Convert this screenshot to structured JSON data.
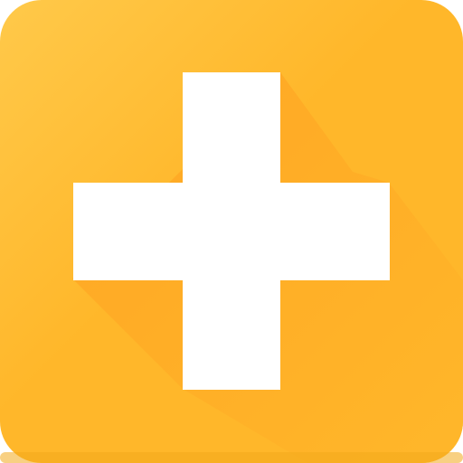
{
  "icon": {
    "name": "plus-icon",
    "colors": {
      "tile_light": "#FFC94A",
      "tile_main": "#FFB72A",
      "tile_edge": "#F3A91C",
      "long_shadow": "#FFA322",
      "cross": "#FFFFFF"
    }
  }
}
